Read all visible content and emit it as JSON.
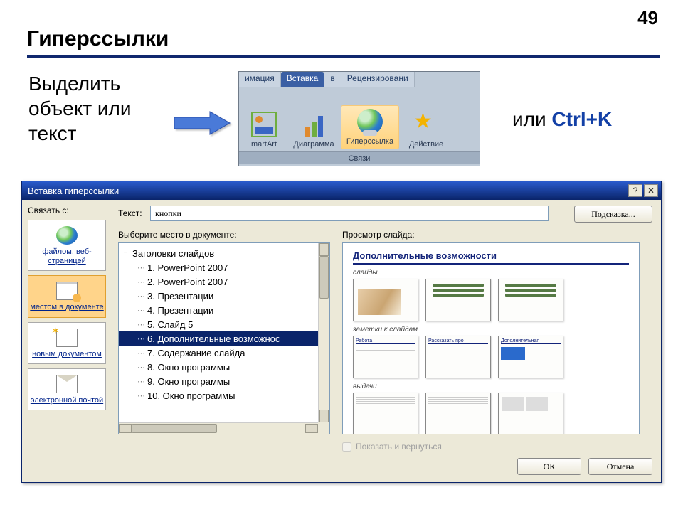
{
  "page": {
    "number": "49",
    "title": "Гиперссылки"
  },
  "instruction": "Выделить\nобъект или\nтекст",
  "shortcut": {
    "prefix": "или ",
    "key": "Ctrl+K"
  },
  "ribbon": {
    "tabs": [
      "имация",
      "Вставка",
      "в",
      "Рецензировани"
    ],
    "selected_tab": "Вставка",
    "items": {
      "smartart": "martArt",
      "chart": "Диаграмма",
      "hyperlink": "Гиперссылка",
      "action": "Действие"
    },
    "group": "Связи"
  },
  "dialog": {
    "title": "Вставка гиперссылки",
    "link_with": "Связать с:",
    "places": {
      "file": "файлом, веб-страницей",
      "doc": "местом в документе",
      "new": "новым документом",
      "mail": "электронной почтой"
    },
    "text_label": "Текст:",
    "text_value": "кнопки",
    "hint_btn": "Подсказка...",
    "select_label": "Выберите место в документе:",
    "tree": {
      "root": "Заголовки слайдов",
      "items": [
        "1. PowerPoint 2007",
        "2. PowerPoint 2007",
        "3. Презентации",
        "4. Презентации",
        "5. Слайд 5",
        "6. Дополнительные возможнос",
        "7. Содержание слайда",
        "8. Окно программы",
        "9. Окно программы",
        "10. Окно программы"
      ],
      "selected": "6. Дополнительные возможнос"
    },
    "preview_label": "Просмотр слайда:",
    "preview_title": "Дополнительные возможности",
    "preview_sections": {
      "s1": "слайды",
      "s2": "заметки к слайдам",
      "s3": "выдачи"
    },
    "show_return": "Показать и вернуться",
    "ok": "ОК",
    "cancel": "Отмена"
  }
}
